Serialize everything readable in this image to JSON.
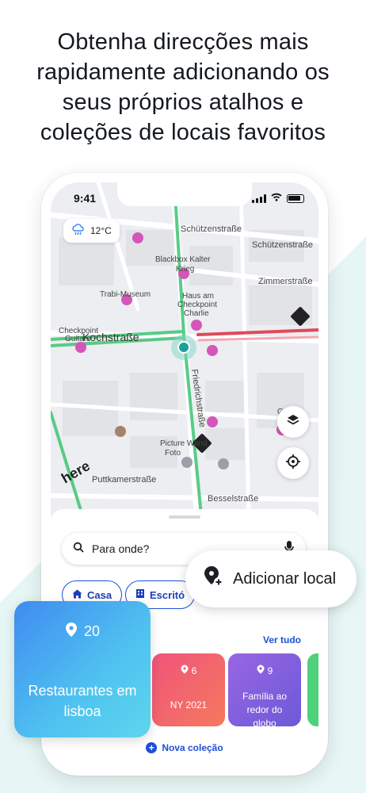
{
  "headline": {
    "line1": "Obtenha direcções mais",
    "line2": "rapidamente adicionando os",
    "line3": "seus próprios atalhos e",
    "line4": "coleções de locais favoritos"
  },
  "status_bar": {
    "time": "9:41"
  },
  "map": {
    "weather": {
      "temperature": "12°C",
      "icon": "cloud-rain-icon"
    },
    "street_labels": [
      "Schützenstraße",
      "Schützenstraße",
      "Zimmerstraße",
      "Kochstraße",
      "Friedrichstraße",
      "Puttkamerstraße",
      "Besselstraße"
    ],
    "poi_labels": [
      "Blackbox Kalter Krieg",
      "Trabi-Museum",
      "Haus am Checkpoint Charlie",
      "Checkpoint Guitars",
      "Picture Wand Foto",
      "Game Cen"
    ],
    "brand": "here",
    "buttons": {
      "layers": "layers-icon",
      "locate": "crosshair-icon"
    }
  },
  "sheet": {
    "search_placeholder": "Para onde?",
    "shortcuts": [
      "Casa",
      "Escritó"
    ],
    "section_fragment": "S",
    "see_all": "Ver tudo",
    "collections": [
      {
        "count": "6",
        "name": "NY 2021",
        "color_from": "#f0547a",
        "color_to": "#f5795f"
      },
      {
        "count": "9",
        "name": "Família ao redor do globo",
        "color_from": "#8f63e0",
        "color_to": "#6a57d8"
      }
    ],
    "new_collection": "Nova coleção"
  },
  "add_place": {
    "label": "Adicionar local"
  },
  "featured_collection": {
    "count": "20",
    "name": "Restaurantes em lisboa"
  },
  "colors": {
    "accent": "#1d4fd8",
    "route_green": "#48c77a",
    "traffic_red": "#e0495a",
    "poi_pink": "#d456b8"
  }
}
